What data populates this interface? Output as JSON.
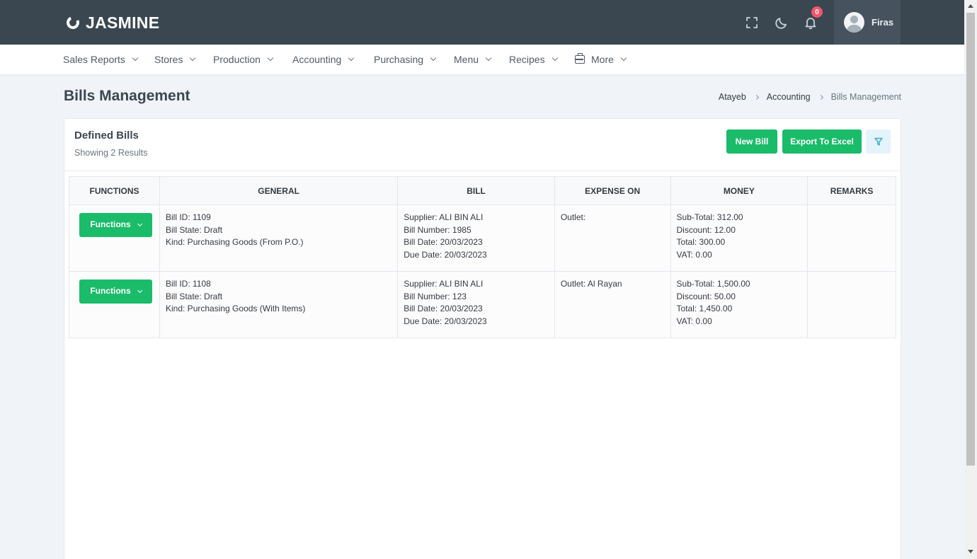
{
  "app": {
    "logo_text": "JASMINE",
    "notification_count": "0",
    "user_name": "Firas"
  },
  "topbar_icons": [
    "fullscreen-icon",
    "moon-icon",
    "bell-icon"
  ],
  "menu": [
    {
      "label": "Sales Reports"
    },
    {
      "label": "Stores"
    },
    {
      "label": "Production"
    },
    {
      "label": "Accounting"
    },
    {
      "label": "Purchasing"
    },
    {
      "label": "Menu"
    },
    {
      "label": "Recipes"
    },
    {
      "label": "More",
      "icon": "briefcase-icon"
    }
  ],
  "page": {
    "title": "Bills Management",
    "breadcrumb": [
      "Atayeb",
      "Accounting",
      "Bills Management"
    ]
  },
  "card": {
    "title": "Defined Bills",
    "subtitle": "Showing 2 Results",
    "new_bill_label": "New Bill",
    "export_label": "Export To Excel",
    "filter_icon": "filter-icon"
  },
  "table": {
    "headers": [
      "FUNCTIONS",
      "GENERAL",
      "BILL",
      "EXPENSE ON",
      "MONEY",
      "REMARKS"
    ],
    "rows": [
      {
        "functions_label": "Functions",
        "general": [
          "Bill ID: 1109",
          "Bill State: Draft",
          "Kind: Purchasing Goods (From P.O.)"
        ],
        "bill": [
          "Supplier: ALI BIN ALI",
          "Bill Number: 1985",
          "Bill Date: 20/03/2023",
          "Due Date: 20/03/2023"
        ],
        "expense_on": "Outlet:",
        "money": [
          "Sub-Total: 312.00",
          "Discount: 12.00",
          "Total: 300.00",
          "VAT: 0.00"
        ],
        "remarks": ""
      },
      {
        "functions_label": "Functions",
        "general": [
          "Bill ID: 1108",
          "Bill State: Draft",
          "Kind: Purchasing Goods (With Items)"
        ],
        "bill": [
          "Supplier: ALI BIN ALI",
          "Bill Number: 123",
          "Bill Date: 20/03/2023",
          "Due Date: 20/03/2023"
        ],
        "expense_on": "Outlet: Al Rayan",
        "money": [
          "Sub-Total: 1,500.00",
          "Discount: 50.00",
          "Total: 1,450.00",
          "VAT: 0.00"
        ],
        "remarks": ""
      }
    ]
  },
  "colors": {
    "topbar": "#3a4650",
    "accent_green": "#1abc6a",
    "badge_red": "#f1556c",
    "background": "#f0f4f8"
  }
}
